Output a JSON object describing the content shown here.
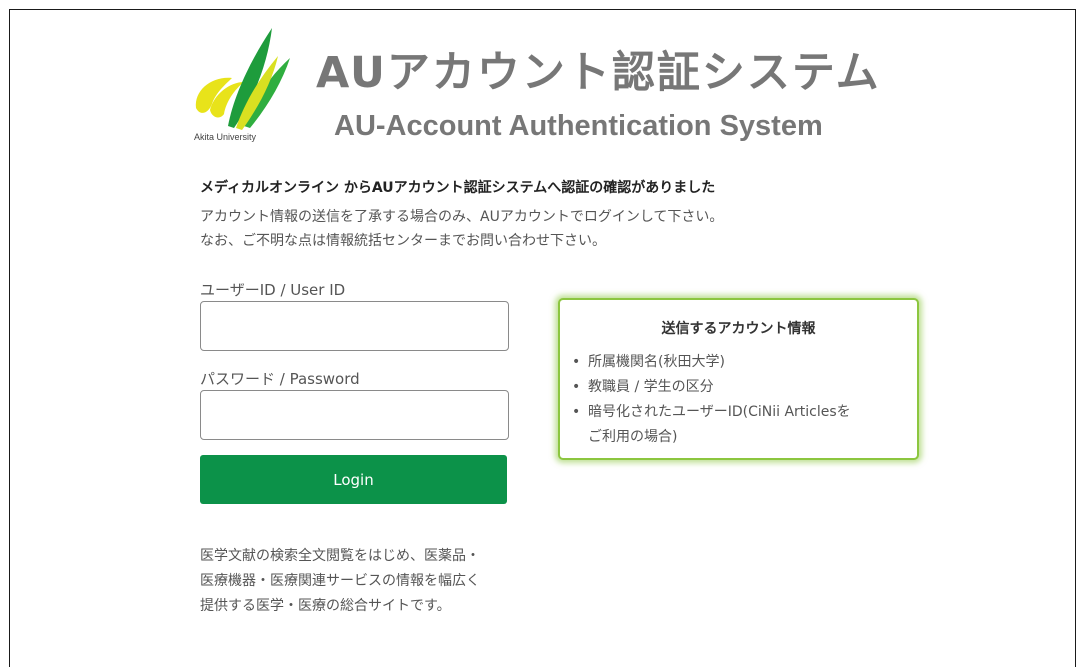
{
  "header": {
    "logo_caption": "Akita University",
    "title_jp": "AUアカウント認証システム",
    "title_en": "AU-Account Authentication System"
  },
  "confirmation": {
    "heading": "メディカルオンライン からAUアカウント認証システムへ認証の確認がありました",
    "line1": "アカウント情報の送信を了承する場合のみ、AUアカウントでログインして下さい。",
    "line2": "なお、ご不明な点は情報統括センターまでお問い合わせ下さい。"
  },
  "form": {
    "user_label": "ユーザーID / User ID",
    "user_value": "",
    "password_label": "パスワード / Password",
    "password_value": "",
    "login_label": "Login"
  },
  "service_note": {
    "line1": "医学文献の検索全文閲覧をはじめ、医薬品・",
    "line2": "医療機器・医療関連サービスの情報を幅広く",
    "line3": "提供する医学・医療の総合サイトです。"
  },
  "info_box": {
    "title": "送信するアカウント情報",
    "items": [
      {
        "text": "所属機関名(秋田大学)",
        "cont": ""
      },
      {
        "text": "教職員 / 学生の区分",
        "cont": ""
      },
      {
        "text": "暗号化されたユーザーID(CiNii Articlesを",
        "cont": "ご利用の場合)"
      }
    ]
  },
  "colors": {
    "login_button": "#0c9249",
    "info_box_border": "#8cc63f",
    "logo_green": "#1e9c3c",
    "logo_yellow": "#e8e31a",
    "title_gray": "#777777"
  },
  "icons": {
    "logo": "akita-university-logo",
    "bullet": "bullet-dot"
  }
}
